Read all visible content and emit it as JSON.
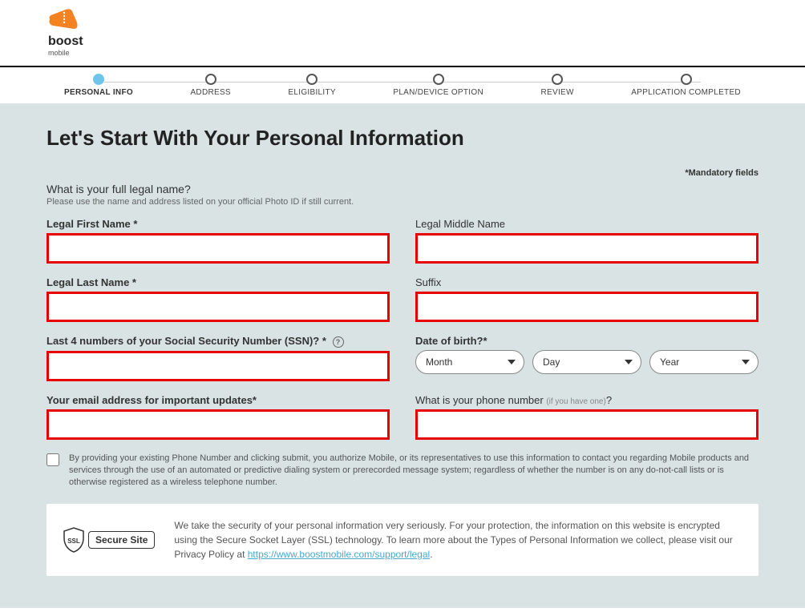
{
  "brand": {
    "name": "boost",
    "sub": "mobile"
  },
  "steps": [
    {
      "label": "PERSONAL INFO",
      "active": true
    },
    {
      "label": "ADDRESS",
      "active": false
    },
    {
      "label": "ELIGIBILITY",
      "active": false
    },
    {
      "label": "PLAN/DEVICE OPTION",
      "active": false
    },
    {
      "label": "REVIEW",
      "active": false
    },
    {
      "label": "APPLICATION COMPLETED",
      "active": false
    }
  ],
  "page": {
    "title": "Let's Start With Your Personal Information",
    "mandatory": "*Mandatory fields",
    "name_q": "What is your full legal name?",
    "name_sub": "Please use the name and address listed on your official Photo ID if still current.",
    "labels": {
      "first": "Legal First Name *",
      "middle": "Legal Middle Name",
      "last": "Legal Last Name  *",
      "suffix": "Suffix",
      "ssn": "Last 4 numbers of your Social Security Number (SSN)? *",
      "dob": "Date of birth?*",
      "email": "Your email address for important updates*",
      "phone": "What is your phone number ",
      "phone_hint": "(if you have one)",
      "phone_q": "?"
    },
    "dob": {
      "month": "Month",
      "day": "Day",
      "year": "Year"
    },
    "consent": "By providing your existing Phone Number and clicking submit, you authorize Mobile, or its representatives to use this information to contact you regarding Mobile products and services through the use of an automated or predictive dialing system or prerecorded message system; regardless of whether the number is on any do-not-call lists or is otherwise registered as a wireless telephone number.",
    "secure": {
      "ssl": "SSL",
      "pill": "Secure Site",
      "text_before": "We take the security of your personal information very seriously. For your protection, the information on this website is encrypted using the Secure Socket Layer (SSL) technology. To learn more about the Types of Personal Information we collect, please visit our Privacy Policy at ",
      "link": "https://www.boostmobile.com/support/legal",
      "text_after": "."
    }
  }
}
